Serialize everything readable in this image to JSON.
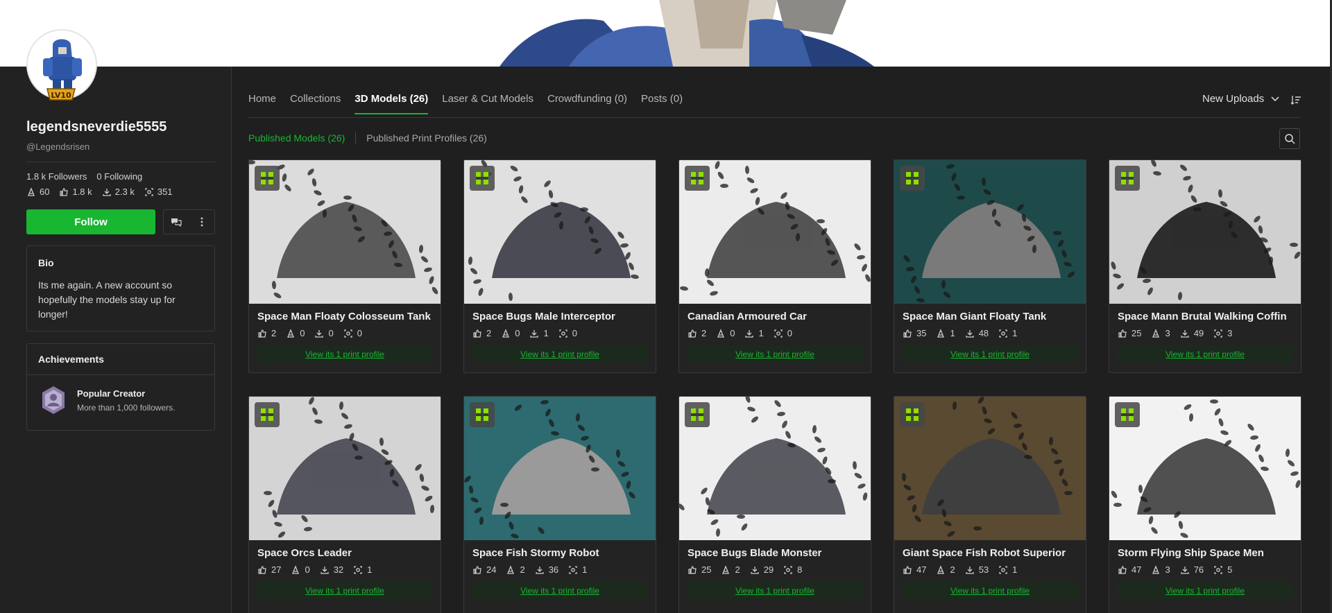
{
  "profile": {
    "username": "legendsneverdie5555",
    "handle": "@Legendsrisen",
    "followers": "1.8 k Followers",
    "following": "0 Following",
    "stats": {
      "prints": "60",
      "likes": "1.8 k",
      "downloads": "2.3 k",
      "boosts": "351"
    },
    "follow_label": "Follow",
    "level_label": "LV10"
  },
  "bio": {
    "heading": "Bio",
    "text": "Its me again. A new account so hopefully the models stay up for longer!"
  },
  "achievements": {
    "heading": "Achievements",
    "title": "Popular Creator",
    "desc": "More than 1,000 followers."
  },
  "tabs": [
    "Home",
    "Collections",
    "3D Models (26)",
    "Laser & Cut Models",
    "Crowdfunding (0)",
    "Posts (0)"
  ],
  "sort_label": "New Uploads",
  "subtabs": {
    "published": "Published Models (26)",
    "print_profiles": "Published Print Profiles (26)"
  },
  "cards": [
    {
      "title": "Space Man Floaty Colosseum Tank",
      "likes": "2",
      "prints": "0",
      "downloads": "0",
      "boosts": "0",
      "link": "View its 1 print profile"
    },
    {
      "title": "Space Bugs Male Interceptor",
      "likes": "2",
      "prints": "0",
      "downloads": "1",
      "boosts": "0",
      "link": "View its 1 print profile"
    },
    {
      "title": "Canadian Armoured Car",
      "likes": "2",
      "prints": "0",
      "downloads": "1",
      "boosts": "0",
      "link": "View its 1 print profile"
    },
    {
      "title": "Space Man Giant Floaty Tank",
      "likes": "35",
      "prints": "1",
      "downloads": "48",
      "boosts": "1",
      "link": "View its 1 print profile"
    },
    {
      "title": "Space Mann Brutal Walking Coffin",
      "likes": "25",
      "prints": "3",
      "downloads": "49",
      "boosts": "3",
      "link": "View its 1 print profile"
    },
    {
      "title": "Space Orcs Leader",
      "likes": "27",
      "prints": "0",
      "downloads": "32",
      "boosts": "1",
      "link": "View its 1 print profile"
    },
    {
      "title": "Space Fish Stormy Robot",
      "likes": "24",
      "prints": "2",
      "downloads": "36",
      "boosts": "1",
      "link": "View its 1 print profile"
    },
    {
      "title": "Space Bugs Blade Monster",
      "likes": "25",
      "prints": "2",
      "downloads": "29",
      "boosts": "8",
      "link": "View its 1 print profile"
    },
    {
      "title": "Giant Space Fish Robot Superior",
      "likes": "47",
      "prints": "2",
      "downloads": "53",
      "boosts": "1",
      "link": "View its 1 print profile"
    },
    {
      "title": "Storm Flying Ship Space Men",
      "likes": "47",
      "prints": "3",
      "downloads": "76",
      "boosts": "5",
      "link": "View its 1 print profile"
    }
  ],
  "colors": {
    "accent": "#19b632",
    "background": "#1f1f1f",
    "sidebar": "#222222"
  }
}
